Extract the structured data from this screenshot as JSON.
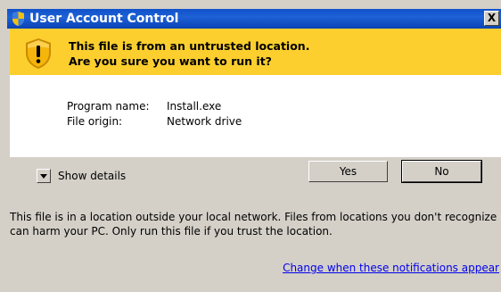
{
  "title": "User Account Control",
  "close_label": "X",
  "banner": {
    "line1": "This file is from an untrusted location.",
    "line2": "Are you sure you want to run it?"
  },
  "program": {
    "name_label": "Program name:",
    "name_value": "Install.exe",
    "origin_label": "File origin:",
    "origin_value": "Network drive"
  },
  "details": {
    "label": "Show details"
  },
  "buttons": {
    "yes": "Yes",
    "no": "No"
  },
  "info": {
    "line1": "This file is in a location outside your local network. Files from locations you don't recognize",
    "line2": "can harm your PC. Only run this file if you trust the location."
  },
  "link": "Change when these notifications appear",
  "colors": {
    "title_bar": "#0f51c9",
    "banner": "#fccf2e",
    "dialog_bg": "#d4d0c8",
    "link": "#0000ee"
  },
  "icons": {
    "title": "shield-icon",
    "banner": "warning-shield-icon"
  }
}
